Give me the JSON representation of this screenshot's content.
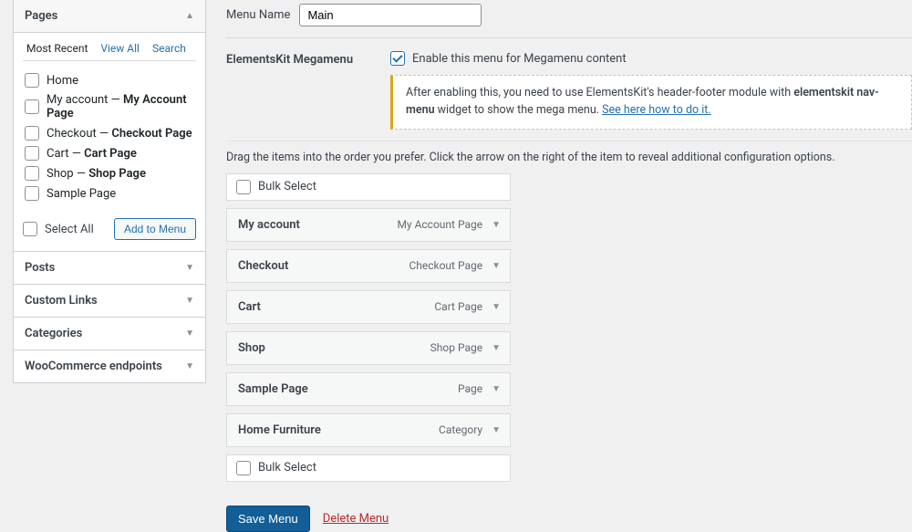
{
  "sidebar": {
    "pages": {
      "title": "Pages",
      "tabs": {
        "recent": "Most Recent",
        "viewall": "View All",
        "search": "Search"
      },
      "items": [
        {
          "label": "Home",
          "sub": ""
        },
        {
          "label": "My account — ",
          "sub": "My Account Page"
        },
        {
          "label": "Checkout — ",
          "sub": "Checkout Page"
        },
        {
          "label": "Cart — ",
          "sub": "Cart Page"
        },
        {
          "label": "Shop — ",
          "sub": "Shop Page"
        },
        {
          "label": "Sample Page",
          "sub": ""
        }
      ],
      "select_all": "Select All",
      "add_to_menu": "Add to Menu"
    },
    "panels": {
      "posts": "Posts",
      "custom_links": "Custom Links",
      "categories": "Categories",
      "woo": "WooCommerce endpoints"
    }
  },
  "main": {
    "menu_name_label": "Menu Name",
    "menu_name_value": "Main",
    "megamenu_label": "ElementsKit Megamenu",
    "enable_label": "Enable this menu for Megamenu content",
    "notice_pre": "After enabling this, you need to use ElementsKit's header-footer module with ",
    "notice_strong": "elementskit nav-menu",
    "notice_post": " widget to show the mega menu. ",
    "notice_link": "See here how to do it.",
    "help_text": "Drag the items into the order you prefer. Click the arrow on the right of the item to reveal additional configuration options.",
    "bulk_select": "Bulk Select",
    "menu_items": [
      {
        "title": "My account",
        "type": "My Account Page"
      },
      {
        "title": "Checkout",
        "type": "Checkout Page"
      },
      {
        "title": "Cart",
        "type": "Cart Page"
      },
      {
        "title": "Shop",
        "type": "Shop Page"
      },
      {
        "title": "Sample Page",
        "type": "Page"
      },
      {
        "title": "Home Furniture",
        "type": "Category"
      }
    ],
    "save_button": "Save Menu",
    "delete_link": "Delete Menu"
  }
}
